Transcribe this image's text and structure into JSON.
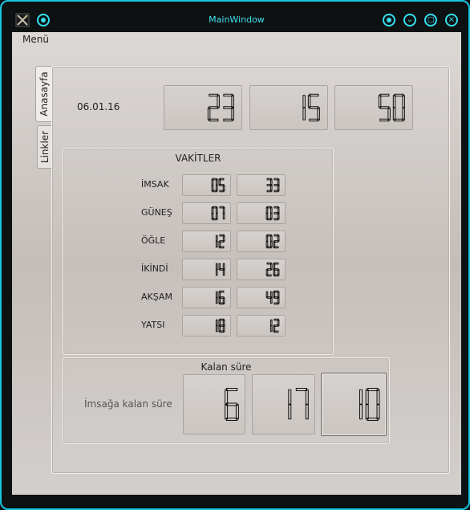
{
  "window": {
    "title": "MainWindow"
  },
  "menu": {
    "label": "Menü"
  },
  "tabs": [
    {
      "label": "Anasayfa"
    },
    {
      "label": "Linkler"
    }
  ],
  "home": {
    "date": "06.01.16",
    "clock": {
      "hour": "23",
      "minute": "15",
      "second": "50"
    }
  },
  "vakitler": {
    "title": "VAKİTLER",
    "rows": [
      {
        "name": "İMSAK",
        "hour": "05",
        "minute": "33"
      },
      {
        "name": "GÜNEŞ",
        "hour": "07",
        "minute": "03"
      },
      {
        "name": "ÖĞLE",
        "hour": "12",
        "minute": "02"
      },
      {
        "name": "İKİNDİ",
        "hour": "14",
        "minute": "26"
      },
      {
        "name": "AKŞAM",
        "hour": "16",
        "minute": "49"
      },
      {
        "name": "YATSI",
        "hour": "18",
        "minute": "12"
      }
    ]
  },
  "kalan": {
    "title": "Kalan süre",
    "label": "İmsağa kalan süre",
    "hours": "6",
    "minutes": "17",
    "seconds": "10"
  },
  "colors": {
    "accent": "#14c8e0",
    "lcd_segment": "#111111"
  },
  "icons": {
    "app": "app-logo-icon",
    "pin": "pin-icon",
    "menu": "menu-icon",
    "minimize": "minimize-icon",
    "maximize": "maximize-icon",
    "close": "close-icon"
  }
}
